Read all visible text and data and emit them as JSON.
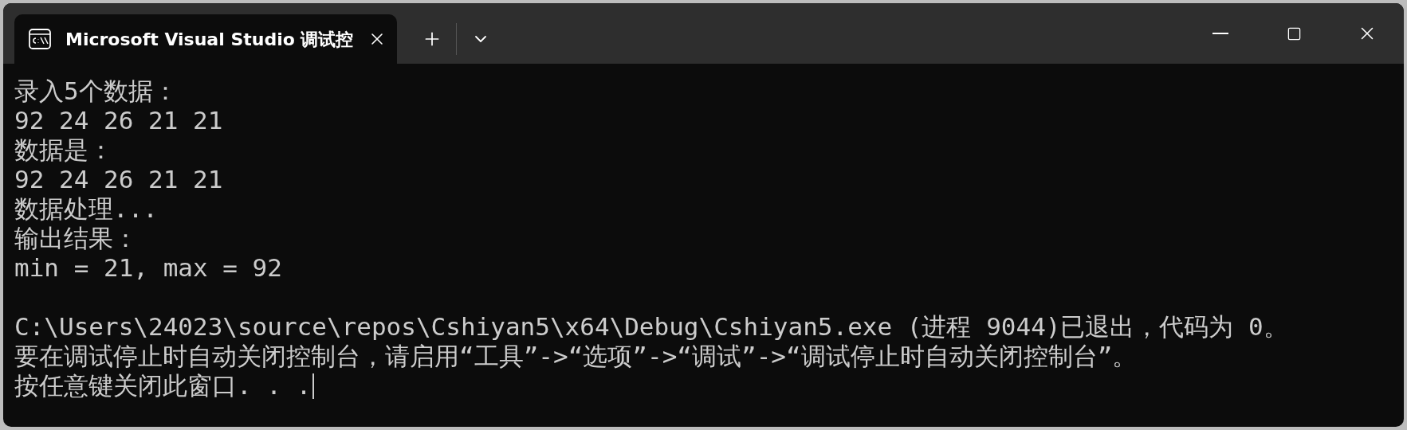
{
  "tab": {
    "title": "Microsoft Visual Studio 调试控",
    "selected": true
  },
  "output_blocks": [
    [
      "录入5个数据：",
      "92 24 26 21 21",
      "数据是：",
      "92 24 26 21 21",
      "数据处理...",
      "输出结果：",
      "min = 21, max = 92"
    ],
    [
      "C:\\Users\\24023\\source\\repos\\Cshiyan5\\x64\\Debug\\Cshiyan5.exe (进程 9044)已退出，代码为 0。",
      "要在调试停止时自动关闭控制台，请启用“工具”->“选项”->“调试”->“调试停止时自动关闭控制台”。",
      "按任意键关闭此窗口. . ."
    ]
  ],
  "cursor_visible": true
}
